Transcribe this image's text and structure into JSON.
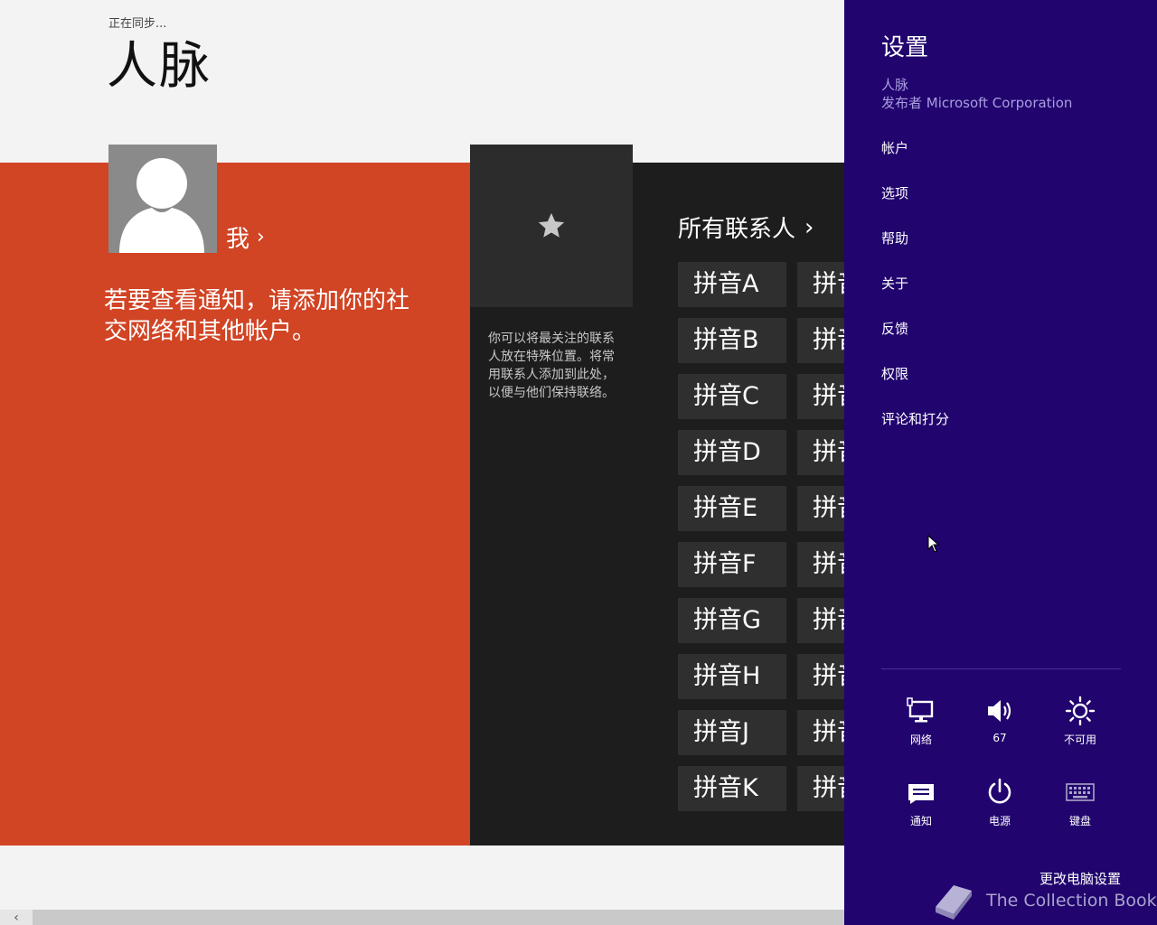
{
  "app": {
    "sync_status": "正在同步...",
    "title": "人脉",
    "me_label": "我",
    "me_chevron": "›",
    "notice": "若要查看通知，请添加你的社交网络和其他帐户。",
    "favorites_text": "你可以将最关注的联系人放在特殊位置。将常用联系人添加到此处，以便与他们保持联络。",
    "all_contacts_label": "所有联系人",
    "all_contacts_chevron": "›",
    "contact_tiles_col1": [
      "拼音A",
      "拼音B",
      "拼音C",
      "拼音D",
      "拼音E",
      "拼音F",
      "拼音G",
      "拼音H",
      "拼音J",
      "拼音K"
    ],
    "contact_tiles_col2": [
      "拼音",
      "拼音",
      "拼音",
      "拼音",
      "拼音",
      "拼音",
      "拼音",
      "拼音",
      "拼音",
      "拼音"
    ],
    "scroll_left_arrow": "‹",
    "colors": {
      "me_panel": "#d14424",
      "dark_panel": "#1d1d1d",
      "tile": "#2f2f2f"
    }
  },
  "charm": {
    "title": "设置",
    "app_name": "人脉",
    "publisher": "发布者 Microsoft Corporation",
    "menu": [
      "帐户",
      "选项",
      "帮助",
      "关于",
      "反馈",
      "权限",
      "评论和打分"
    ],
    "quick_settings": [
      {
        "label": "网络",
        "icon": "network-icon"
      },
      {
        "label": "67",
        "icon": "volume-icon"
      },
      {
        "label": "不可用",
        "icon": "brightness-icon"
      },
      {
        "label": "通知",
        "icon": "notifications-icon"
      },
      {
        "label": "电源",
        "icon": "power-icon"
      },
      {
        "label": "键盘",
        "icon": "keyboard-icon"
      }
    ],
    "change_pc_settings": "更改电脑设置",
    "watermark": "The Collection Book",
    "colors": {
      "background": "#21046e",
      "accent_text": "#a99de0"
    }
  }
}
